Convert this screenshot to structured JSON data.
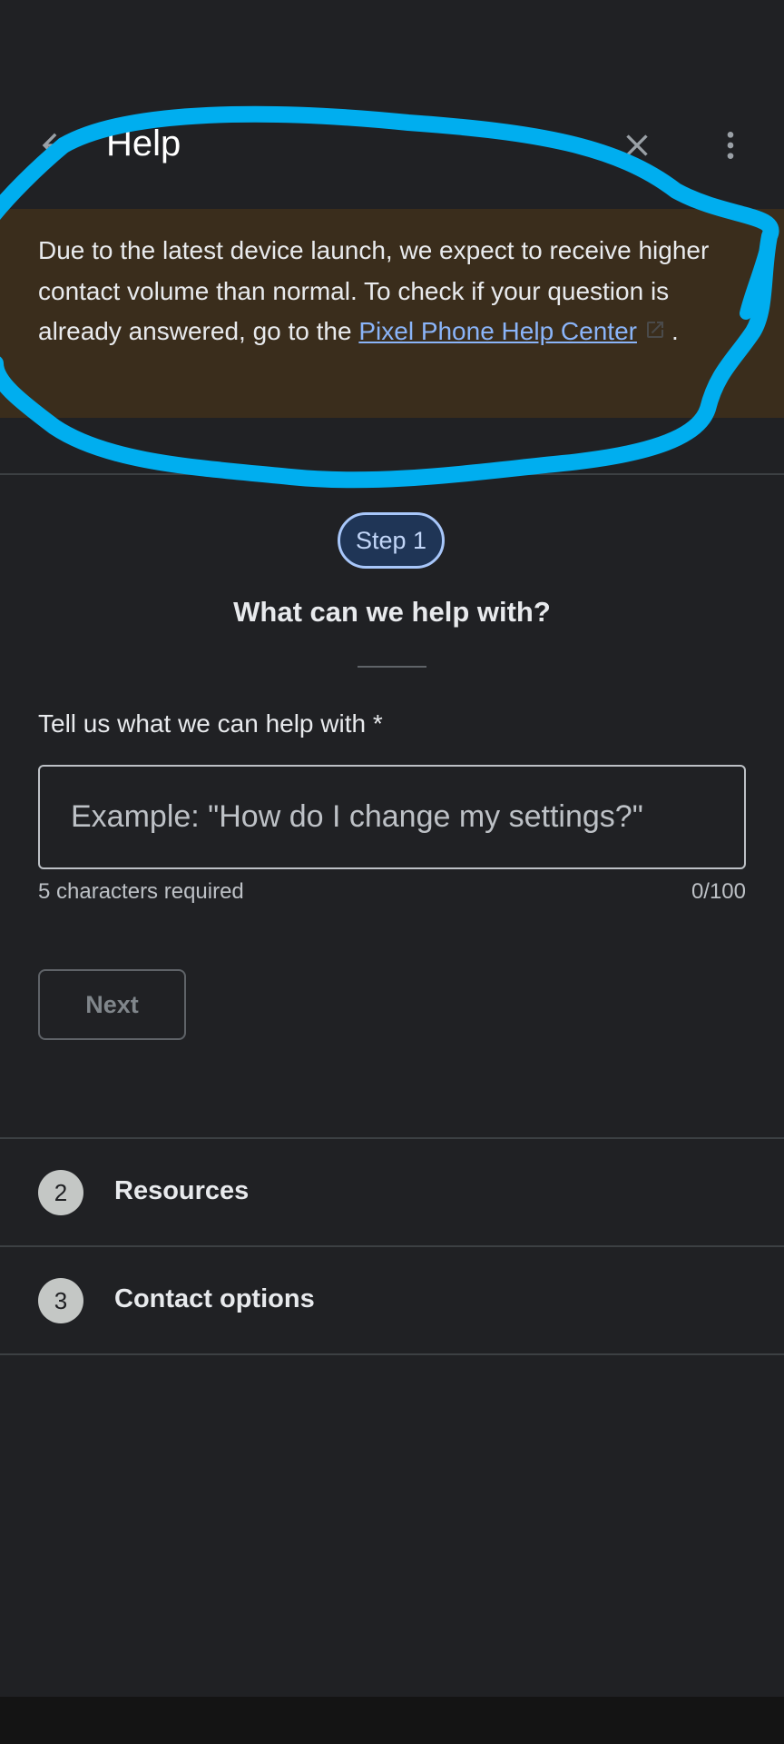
{
  "app_bar": {
    "title": "Help",
    "back_icon": "arrow-back-icon",
    "close_icon": "close-icon",
    "more_icon": "more-vert-icon"
  },
  "banner": {
    "text": "Due to the latest device launch, we expect to receive higher contact volume than normal. To check if your question is already answered, go to the ",
    "link_text": "Pixel Phone Help Center",
    "link_icon": "open-in-new-icon",
    "trailing": ".",
    "background": "#3a2d1c",
    "link_color": "#8ab4f8"
  },
  "step1": {
    "chip": "Step 1",
    "heading": "What can we help with?",
    "field_label": "Tell us what we can help with *",
    "placeholder": "Example: \"How do I change my settings?\"",
    "value": "",
    "helper": "5 characters required",
    "count": "0/100",
    "next_label": "Next",
    "accent": "#a8c7fa"
  },
  "steps": [
    {
      "number": "2",
      "label": "Resources"
    },
    {
      "number": "3",
      "label": "Contact options"
    }
  ],
  "annotation": {
    "color": "#00aeef",
    "shape": "freehand circle around header and banner"
  }
}
